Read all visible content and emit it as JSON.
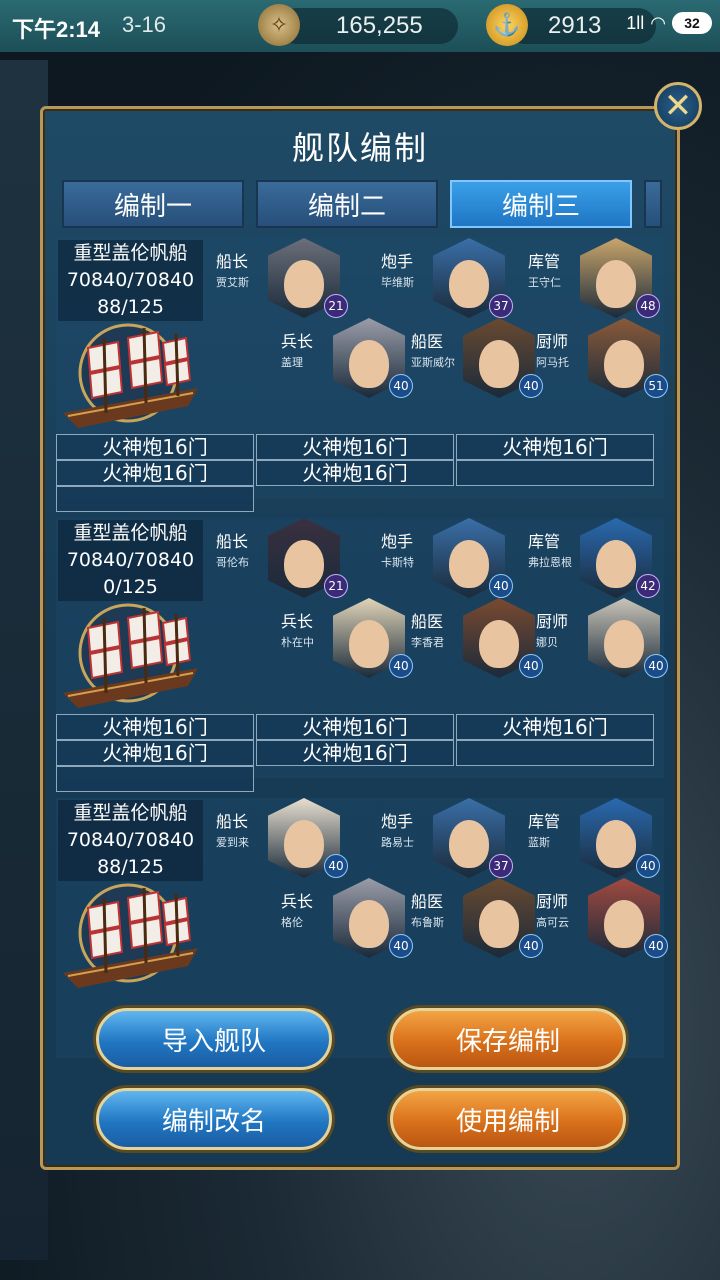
{
  "status_bar": {
    "time": "下午2:14",
    "date": "3-16",
    "compass_value": "165,255",
    "anchor_value": "2913",
    "signal_label": "1ll",
    "battery": "32"
  },
  "panel": {
    "title": "舰队编制",
    "close_icon": "close-icon"
  },
  "tabs": [
    {
      "label": "编制一",
      "active": false
    },
    {
      "label": "编制二",
      "active": false
    },
    {
      "label": "编制三",
      "active": true
    }
  ],
  "ships": [
    {
      "type": "重型盖伦帆船",
      "durability": "70840/70840",
      "sailors": "88/125",
      "crew": [
        {
          "role": "船长",
          "name": "贾艾斯",
          "level": "21",
          "color": "#6b6f7a"
        },
        {
          "role": "炮手",
          "name": "毕维斯",
          "level": "37",
          "color": "#3a6fa8"
        },
        {
          "role": "库管",
          "name": "王守仁",
          "level": "48",
          "color": "#c9a56a"
        },
        {
          "role": "兵长",
          "name": "盖理",
          "level": "40",
          "color": "#9a9da8"
        },
        {
          "role": "船医",
          "name": "亚斯威尔",
          "level": "40",
          "color": "#6a4a30"
        },
        {
          "role": "厨师",
          "name": "阿马托",
          "level": "51",
          "color": "#8a5a3a"
        }
      ],
      "cannons": [
        "火神炮16门",
        "火神炮16门",
        "火神炮16门",
        "火神炮16门",
        "火神炮16门",
        "",
        ""
      ]
    },
    {
      "type": "重型盖伦帆船",
      "durability": "70840/70840",
      "sailors": "0/125",
      "crew": [
        {
          "role": "船长",
          "name": "哥伦布",
          "level": "21",
          "color": "#3a3040"
        },
        {
          "role": "炮手",
          "name": "卡斯特",
          "level": "40",
          "color": "#3a6fa8"
        },
        {
          "role": "库管",
          "name": "弗拉恩根",
          "level": "42",
          "color": "#2a6ab0"
        },
        {
          "role": "兵长",
          "name": "朴在中",
          "level": "40",
          "color": "#e0d4b8"
        },
        {
          "role": "船医",
          "name": "李香君",
          "level": "40",
          "color": "#7a4a30"
        },
        {
          "role": "厨师",
          "name": "娜贝",
          "level": "40",
          "color": "#c9c4b8"
        }
      ],
      "cannons": [
        "火神炮16门",
        "火神炮16门",
        "火神炮16门",
        "火神炮16门",
        "火神炮16门",
        "",
        ""
      ]
    },
    {
      "type": "重型盖伦帆船",
      "durability": "70840/70840",
      "sailors": "88/125",
      "crew": [
        {
          "role": "船长",
          "name": "爱到来",
          "level": "40",
          "color": "#e8e0d0"
        },
        {
          "role": "炮手",
          "name": "路易士",
          "level": "37",
          "color": "#3a6fa8"
        },
        {
          "role": "库管",
          "name": "蓝斯",
          "level": "40",
          "color": "#2a6ab0"
        },
        {
          "role": "兵长",
          "name": "格伦",
          "level": "40",
          "color": "#9a9da8"
        },
        {
          "role": "船医",
          "name": "布鲁斯",
          "level": "40",
          "color": "#6a4a30"
        },
        {
          "role": "厨师",
          "name": "高可云",
          "level": "40",
          "color": "#a04a40"
        }
      ],
      "cannons": []
    }
  ],
  "buttons": {
    "import": "导入舰队",
    "save": "保存编制",
    "rename": "编制改名",
    "use": "使用编制"
  }
}
